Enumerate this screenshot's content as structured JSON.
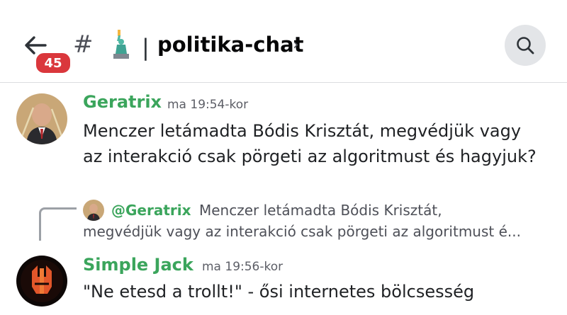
{
  "header": {
    "unread_count": "45",
    "hash_symbol": "#",
    "channel_emoji": "statue-of-liberty",
    "separator": "|",
    "channel_name": "politika-chat",
    "chevron": "›"
  },
  "messages": [
    {
      "author": "Geratrix",
      "timestamp": "ma 19:54-kor",
      "line1": "Menczer letámadta Bódis Krisztát, megvédjük vagy",
      "line2": "az interakció csak pörgeti az algoritmust és hagyjuk?"
    },
    {
      "reply": {
        "author": "@Geratrix",
        "text1": "Menczer letámadta Bódis Krisztát,",
        "text2": "megvédjük vagy az interakció csak pörgeti az algoritmust é..."
      },
      "author": "Simple Jack",
      "timestamp": "ma 19:56-kor",
      "line1": "\"Ne etesd a trollt!\" - ősi internetes bölcsesség"
    }
  ],
  "colors": {
    "author_green": "#3ba55c",
    "badge_red": "#da373c",
    "search_bg": "#e3e5e8"
  }
}
